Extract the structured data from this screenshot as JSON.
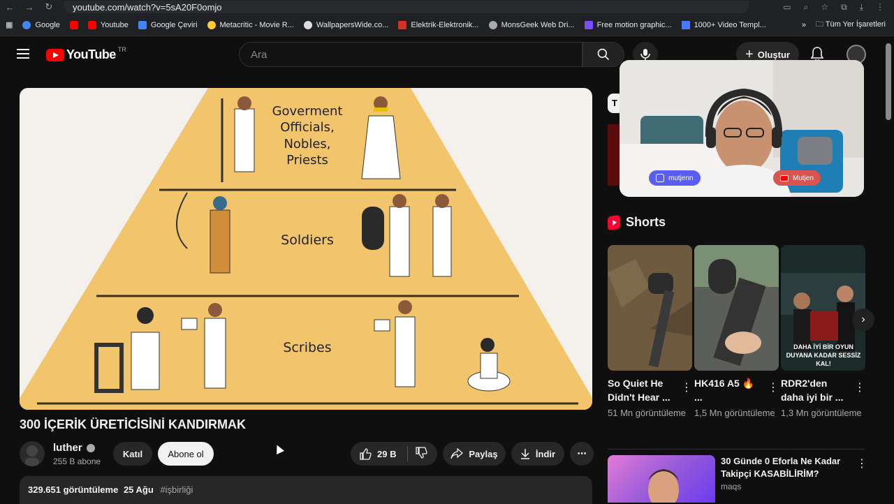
{
  "browser": {
    "url": "youtube.com/watch?v=5sA20F0omjo",
    "bookmarks": [
      {
        "label": "Google",
        "color": "#4285f4"
      },
      {
        "label": "",
        "color": "#ff0000"
      },
      {
        "label": "Youtube",
        "color": "#ff0000"
      },
      {
        "label": "Google Çeviri",
        "color": "#4285f4"
      },
      {
        "label": "Metacritic - Movie R...",
        "color": "#ffcc33"
      },
      {
        "label": "WallpapersWide.co...",
        "color": "#dddddd"
      },
      {
        "label": "Elektrik-Elektronik...",
        "color": "#d93025"
      },
      {
        "label": "MonsGeek Web Dri...",
        "color": "#aaaaaa"
      },
      {
        "label": "Free motion graphic...",
        "color": "#7b4dff"
      },
      {
        "label": "1000+ Video Templ...",
        "color": "#4a78ff"
      }
    ],
    "all_bookmarks": "Tüm Yer İşaretleri"
  },
  "header": {
    "logo_text": "YouTube",
    "logo_region": "TR",
    "search_placeholder": "Ara",
    "create_label": "Oluştur"
  },
  "video": {
    "pyramid_tiers": {
      "tier1": "Goverment\nOfficials,\nNobles,\nPriests",
      "tier2": "Soldiers",
      "tier3": "Scribes"
    },
    "title": "300 İÇERİK ÜRETİCİSİNİ KANDIRMAK",
    "channel": "luther",
    "subscribers": "255 B abone",
    "join_label": "Katıl",
    "subscribe_label": "Abone ol",
    "likes": "29 B",
    "share_label": "Paylaş",
    "download_label": "İndir",
    "views": "329.651 görüntüleme",
    "date": "25 Ağu",
    "hashtag": "#işbirliği"
  },
  "camera": {
    "instagram_handle": "mutjenn",
    "youtube_handle": "Mutjen"
  },
  "sidebar": {
    "chip_label": "T",
    "shorts_title": "Shorts",
    "shorts": [
      {
        "title": "So Quiet He Didn't Hear ...",
        "views": "51 Mn görüntüleme"
      },
      {
        "title": "HK416 A5 🔥 ...",
        "views": "1,5 Mn görüntüleme"
      },
      {
        "title": "RDR2'den daha iyi bir ...",
        "views": "1,3 Mn görüntüleme",
        "overlay": "DAHA İYİ BİR OYUN DUYANA KADAR SESSİZ KAL!"
      }
    ],
    "recommended": {
      "title": "30 Günde 0 Eforla Ne Kadar Takipçi KASABİLİRİM?",
      "channel": "maqs"
    }
  },
  "colors": {
    "background": "#0f0f0f",
    "pyramid": "#f2c46c",
    "accent": "#ff0000"
  }
}
